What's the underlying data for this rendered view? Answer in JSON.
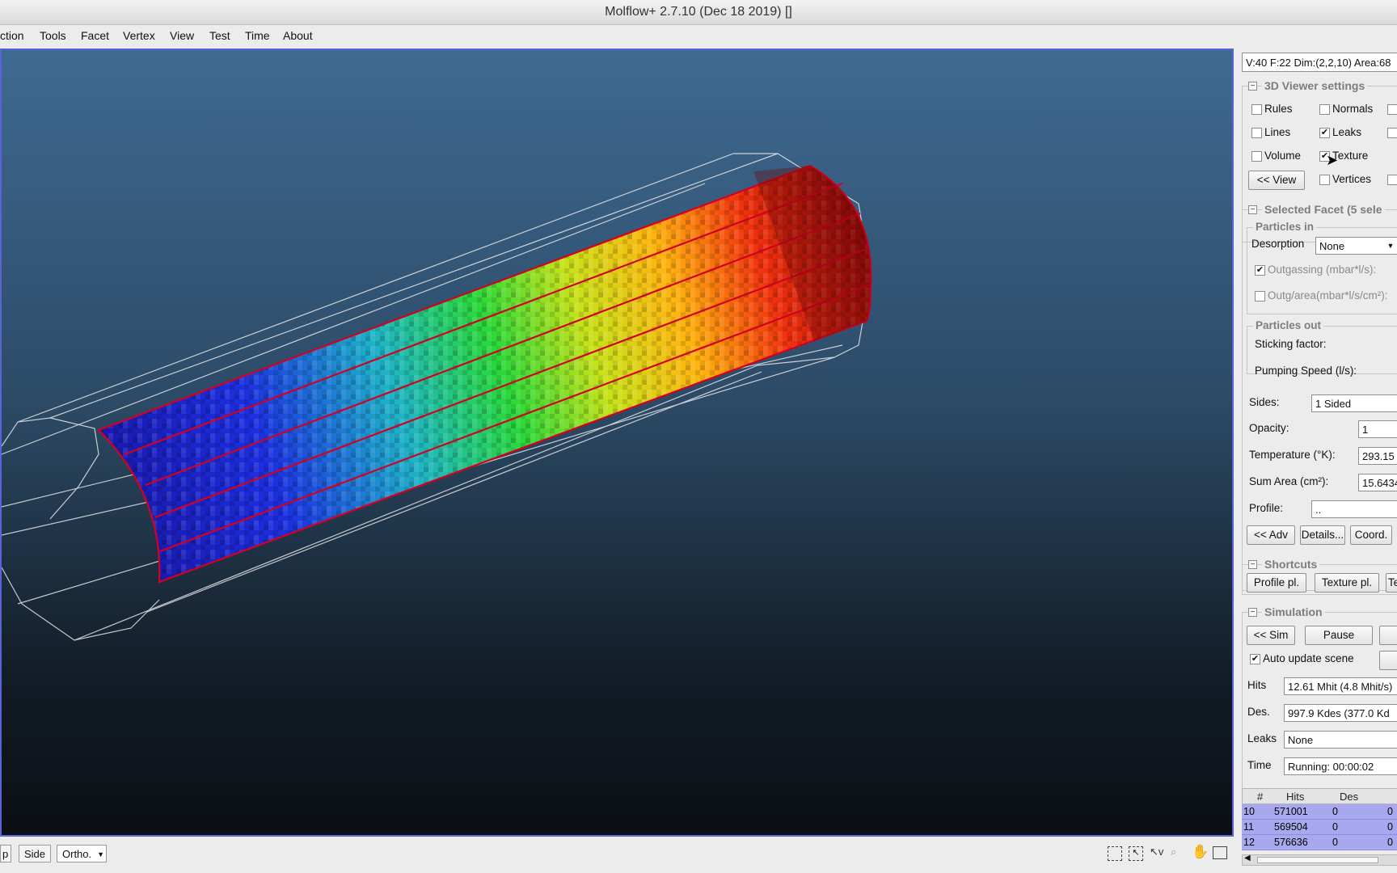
{
  "window": {
    "title": "Molflow+ 2.7.10 (Dec 18 2019) []"
  },
  "menu": [
    "ction",
    "Tools",
    "Facet",
    "Vertex",
    "View",
    "Test",
    "Time",
    "About"
  ],
  "bottom_toolbar": {
    "btn_partial": "p",
    "side": "Side",
    "projection": "Ortho."
  },
  "panel": {
    "geometry_info": "V:40 F:22 Dim:(2,2,10) Area:68",
    "viewer_settings": {
      "title": "3D Viewer settings",
      "checks": [
        {
          "label": "Rules",
          "checked": false
        },
        {
          "label": "Normals",
          "checked": false
        },
        {
          "label": "Lines",
          "checked": false
        },
        {
          "label": "Leaks",
          "checked": true
        },
        {
          "label": "Volume",
          "checked": false
        },
        {
          "label": "Texture",
          "checked": true
        },
        {
          "label": "Vertices",
          "checked": false
        }
      ],
      "view_button": "<< View"
    },
    "selected_facet": {
      "title": "Selected Facet (5 sele",
      "particles_in": "Particles in",
      "desorption_label": "Desorption",
      "desorption_value": "None",
      "outgassing_label": "Outgassing (mbar*l/s):",
      "outg_area_label": "Outg/area(mbar*l/s/cm²):",
      "particles_out": "Particles out",
      "sticking_label": "Sticking factor:",
      "pumping_label": "Pumping Speed (l/s):",
      "sides_label": "Sides:",
      "sides_value": "1 Sided",
      "opacity_label": "Opacity:",
      "opacity_value": "1",
      "temperature_label": "Temperature (°K):",
      "temperature_value": "293.15",
      "sum_area_label": "Sum Area (cm²):",
      "sum_area_value": "15.6434",
      "profile_label": "Profile:",
      "profile_value": "..",
      "adv_button": "<< Adv",
      "details_button": "Details...",
      "coord_button": "Coord."
    },
    "shortcuts": {
      "title": "Shortcuts",
      "profile_button": "Profile pl.",
      "texture_button": "Texture pl.",
      "third_button": "Te"
    },
    "simulation": {
      "title": "Simulation",
      "sim_button": "<< Sim",
      "pause_button": "Pause",
      "auto_update_label": "Auto update scene",
      "hits_label": "Hits",
      "hits_value": "12.61 Mhit (4.8 Mhit/s)",
      "des_label": "Des.",
      "des_value": "997.9 Kdes (377.0 Kd",
      "leaks_label": "Leaks",
      "leaks_value": "None",
      "time_label": "Time",
      "time_value": "Running: 00:00:02"
    },
    "facet_table": {
      "headers": [
        "#",
        "Hits",
        "Des"
      ],
      "rows": [
        [
          "10",
          "571001",
          "0",
          "0"
        ],
        [
          "11",
          "569504",
          "0",
          "0"
        ],
        [
          "12",
          "576636",
          "0",
          "0"
        ]
      ]
    }
  },
  "colors": {
    "selection_border": "#5b63d9",
    "table_highlight": "#a8a8ee",
    "facet_outline": "#d40020"
  }
}
